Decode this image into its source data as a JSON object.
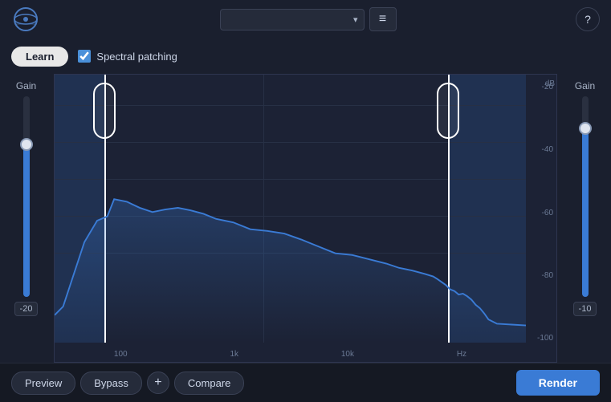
{
  "header": {
    "preset_placeholder": "",
    "menu_icon": "≡",
    "help_icon": "?"
  },
  "toolbar": {
    "learn_label": "Learn",
    "spectral_patching_label": "Spectral patching",
    "spectral_patching_checked": true
  },
  "left_gain": {
    "label": "Gain",
    "value": "-20",
    "fill_height": "190",
    "thumb_bottom": "190"
  },
  "right_gain": {
    "label": "Gain",
    "value": "-10",
    "fill_height": "210",
    "thumb_bottom": "210"
  },
  "eq": {
    "db_labels": [
      "-20",
      "-40",
      "-60",
      "-80",
      "-100"
    ],
    "freq_labels": [
      "100",
      "1k",
      "10k",
      "Hz"
    ]
  },
  "footer": {
    "preview_label": "Preview",
    "bypass_label": "Bypass",
    "plus_label": "+",
    "compare_label": "Compare",
    "render_label": "Render"
  }
}
